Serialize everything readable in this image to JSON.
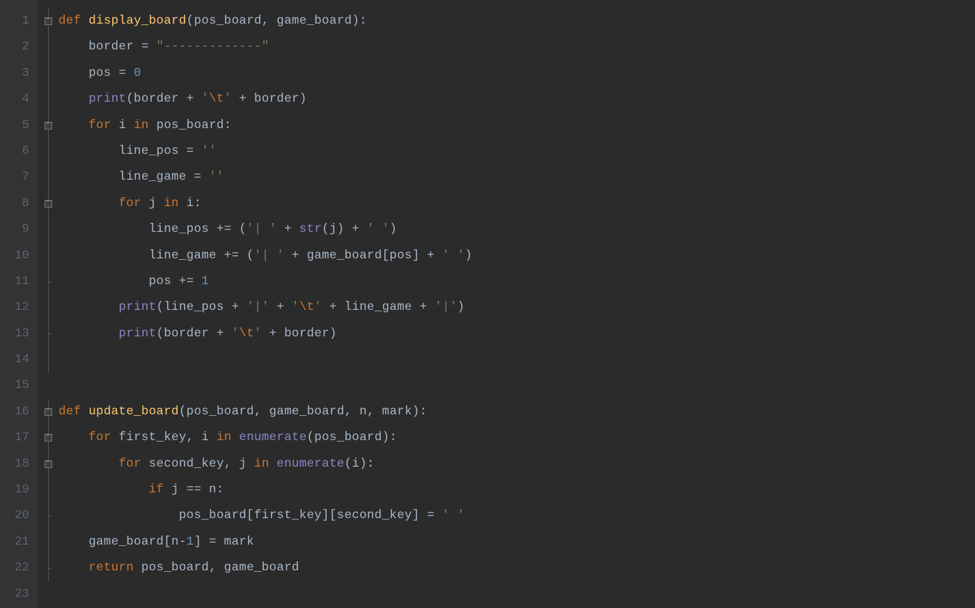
{
  "gutter": [
    "1",
    "2",
    "3",
    "4",
    "5",
    "6",
    "7",
    "8",
    "9",
    "10",
    "11",
    "12",
    "13",
    "14",
    "15",
    "16",
    "17",
    "18",
    "19",
    "20",
    "21",
    "22",
    "23"
  ],
  "fold": [
    {
      "line": 0,
      "type": "open-start"
    },
    {
      "line": 4,
      "type": "open"
    },
    {
      "line": 7,
      "type": "open"
    },
    {
      "line": 10,
      "type": "end"
    },
    {
      "line": 12,
      "type": "end"
    },
    {
      "line": 15,
      "type": "open-start"
    },
    {
      "line": 16,
      "type": "open"
    },
    {
      "line": 17,
      "type": "open"
    },
    {
      "line": 19,
      "type": "end"
    },
    {
      "line": 21,
      "type": "end"
    }
  ],
  "code": [
    [
      {
        "t": "def ",
        "c": "k"
      },
      {
        "t": "display_board",
        "c": "fn"
      },
      {
        "t": "(pos_board",
        "c": "id"
      },
      {
        "t": ", ",
        "c": "p"
      },
      {
        "t": "game_board):",
        "c": "id"
      }
    ],
    [
      {
        "t": "    border = ",
        "c": "id"
      },
      {
        "t": "\"-------------\"",
        "c": "s"
      }
    ],
    [
      {
        "t": "    pos = ",
        "c": "id"
      },
      {
        "t": "0",
        "c": "n"
      }
    ],
    [
      {
        "t": "    ",
        "c": "id"
      },
      {
        "t": "print",
        "c": "bi"
      },
      {
        "t": "(border + ",
        "c": "id"
      },
      {
        "t": "'",
        "c": "s"
      },
      {
        "t": "\\t",
        "c": "k"
      },
      {
        "t": "'",
        "c": "s"
      },
      {
        "t": " + border)",
        "c": "id"
      }
    ],
    [
      {
        "t": "    ",
        "c": "id"
      },
      {
        "t": "for ",
        "c": "k"
      },
      {
        "t": "i ",
        "c": "id"
      },
      {
        "t": "in ",
        "c": "k"
      },
      {
        "t": "pos_board:",
        "c": "id"
      }
    ],
    [
      {
        "t": "        line_pos = ",
        "c": "id"
      },
      {
        "t": "''",
        "c": "s"
      }
    ],
    [
      {
        "t": "        line_game = ",
        "c": "id"
      },
      {
        "t": "''",
        "c": "s"
      }
    ],
    [
      {
        "t": "        ",
        "c": "id"
      },
      {
        "t": "for ",
        "c": "k"
      },
      {
        "t": "j ",
        "c": "id"
      },
      {
        "t": "in ",
        "c": "k"
      },
      {
        "t": "i:",
        "c": "id"
      }
    ],
    [
      {
        "t": "            line_pos += (",
        "c": "id"
      },
      {
        "t": "'| '",
        "c": "s"
      },
      {
        "t": " + ",
        "c": "id"
      },
      {
        "t": "str",
        "c": "bi"
      },
      {
        "t": "(j) + ",
        "c": "id"
      },
      {
        "t": "' '",
        "c": "s"
      },
      {
        "t": ")",
        "c": "id"
      }
    ],
    [
      {
        "t": "            line_game += (",
        "c": "id"
      },
      {
        "t": "'| '",
        "c": "s"
      },
      {
        "t": " + game_board[pos] + ",
        "c": "id"
      },
      {
        "t": "' '",
        "c": "s"
      },
      {
        "t": ")",
        "c": "id"
      }
    ],
    [
      {
        "t": "            pos += ",
        "c": "id"
      },
      {
        "t": "1",
        "c": "n"
      }
    ],
    [
      {
        "t": "        ",
        "c": "id"
      },
      {
        "t": "print",
        "c": "bi"
      },
      {
        "t": "(line_pos + ",
        "c": "id"
      },
      {
        "t": "'|'",
        "c": "s"
      },
      {
        "t": " + ",
        "c": "id"
      },
      {
        "t": "'",
        "c": "s"
      },
      {
        "t": "\\t",
        "c": "k"
      },
      {
        "t": "'",
        "c": "s"
      },
      {
        "t": " + line_game + ",
        "c": "id"
      },
      {
        "t": "'|'",
        "c": "s"
      },
      {
        "t": ")",
        "c": "id"
      }
    ],
    [
      {
        "t": "        ",
        "c": "id"
      },
      {
        "t": "print",
        "c": "bi"
      },
      {
        "t": "(border + ",
        "c": "id"
      },
      {
        "t": "'",
        "c": "s"
      },
      {
        "t": "\\t",
        "c": "k"
      },
      {
        "t": "'",
        "c": "s"
      },
      {
        "t": " + border)",
        "c": "id"
      }
    ],
    [],
    [],
    [
      {
        "t": "def ",
        "c": "k"
      },
      {
        "t": "update_board",
        "c": "fn"
      },
      {
        "t": "(pos_board",
        "c": "id"
      },
      {
        "t": ", ",
        "c": "p"
      },
      {
        "t": "game_board",
        "c": "id"
      },
      {
        "t": ", ",
        "c": "p"
      },
      {
        "t": "n",
        "c": "id"
      },
      {
        "t": ", ",
        "c": "p"
      },
      {
        "t": "mark):",
        "c": "id"
      }
    ],
    [
      {
        "t": "    ",
        "c": "id"
      },
      {
        "t": "for ",
        "c": "k"
      },
      {
        "t": "first_key",
        "c": "id"
      },
      {
        "t": ", ",
        "c": "p"
      },
      {
        "t": "i ",
        "c": "id"
      },
      {
        "t": "in ",
        "c": "k"
      },
      {
        "t": "enumerate",
        "c": "bi"
      },
      {
        "t": "(pos_board):",
        "c": "id"
      }
    ],
    [
      {
        "t": "        ",
        "c": "id"
      },
      {
        "t": "for ",
        "c": "k"
      },
      {
        "t": "second_key",
        "c": "id"
      },
      {
        "t": ", ",
        "c": "p"
      },
      {
        "t": "j ",
        "c": "id"
      },
      {
        "t": "in ",
        "c": "k"
      },
      {
        "t": "enumerate",
        "c": "bi"
      },
      {
        "t": "(i):",
        "c": "id"
      }
    ],
    [
      {
        "t": "            ",
        "c": "id"
      },
      {
        "t": "if ",
        "c": "k"
      },
      {
        "t": "j == n:",
        "c": "id"
      }
    ],
    [
      {
        "t": "                pos_board[first_key][second_key] = ",
        "c": "id"
      },
      {
        "t": "' '",
        "c": "s"
      }
    ],
    [
      {
        "t": "    game_board[n-",
        "c": "id"
      },
      {
        "t": "1",
        "c": "n"
      },
      {
        "t": "] = mark",
        "c": "id"
      }
    ],
    [
      {
        "t": "    ",
        "c": "id"
      },
      {
        "t": "return ",
        "c": "k"
      },
      {
        "t": "pos_board",
        "c": "id"
      },
      {
        "t": ", ",
        "c": "p"
      },
      {
        "t": "game_board",
        "c": "id"
      }
    ],
    []
  ],
  "foldLines23": true
}
